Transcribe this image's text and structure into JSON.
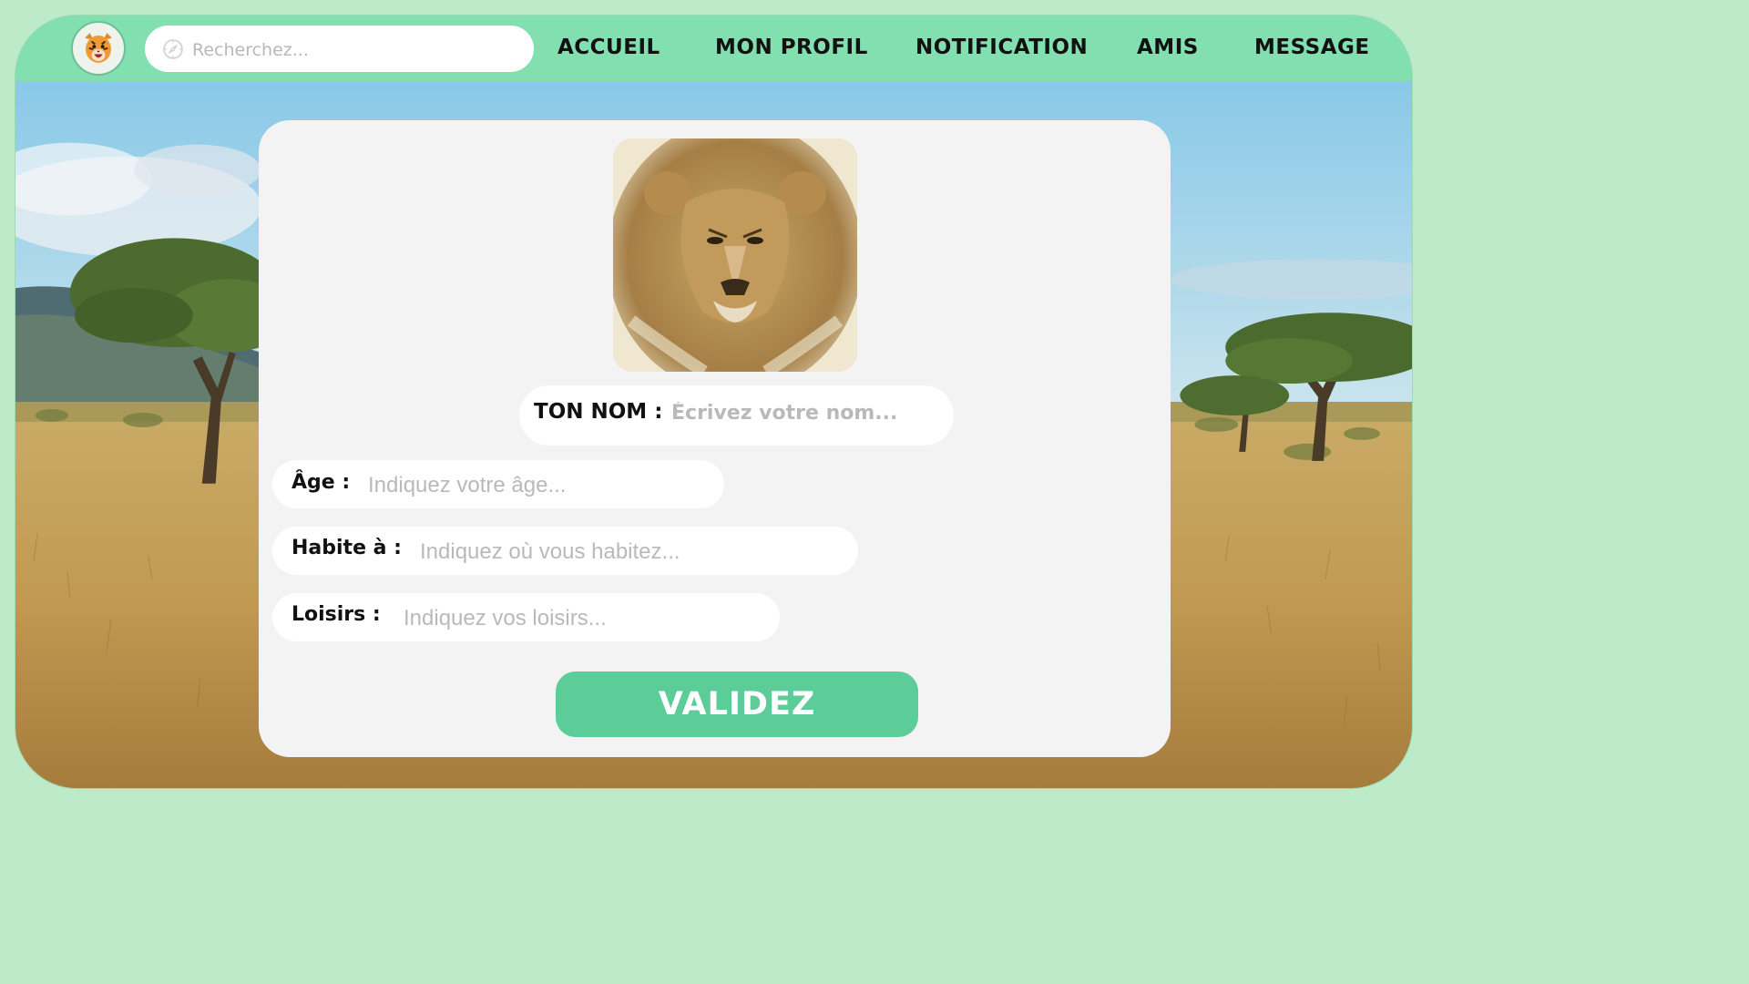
{
  "header": {
    "search_placeholder": "Recherchez...",
    "nav": [
      "ACCUEIL",
      "MON PROFIL",
      "NOTIFICATION",
      "AMIS",
      "MESSAGE"
    ]
  },
  "form": {
    "name_label": "TON NOM :",
    "name_placeholder": "Écrivez votre nom...",
    "age_label": "Âge :",
    "age_placeholder": "Indiquez votre âge...",
    "city_label": "Habite à :",
    "city_placeholder": "Indiquez où vous habitez...",
    "hobbies_label": "Loisirs :",
    "hobbies_placeholder": "Indiquez vos loisirs...",
    "submit_label": "VALIDEZ"
  },
  "colors": {
    "accent": "#82e0b0",
    "button": "#5ccd99",
    "card": "#f3f3f3",
    "page": "#bdebc9"
  },
  "icons": {
    "logo": "tiger-logo-icon",
    "search": "compass-icon"
  },
  "images": {
    "profile_photo": "lion-portrait"
  }
}
